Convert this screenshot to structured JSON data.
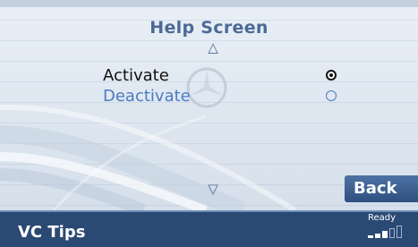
{
  "screen": {
    "title": "Help Screen",
    "scroll_up_symbol": "△",
    "scroll_down_symbol": "▽"
  },
  "options": [
    {
      "label": "Activate",
      "selected": true
    },
    {
      "label": "Deactivate",
      "selected": false
    }
  ],
  "buttons": {
    "back_label": "Back"
  },
  "status_bar": {
    "title": "VC Tips",
    "status": "Ready",
    "signal_level": "3 of 5"
  },
  "colors": {
    "accent": "#4c6a96",
    "option_inactive": "#4a7bc1",
    "status_bar": "#2b4a73",
    "button": "#3d6191"
  },
  "icons": [
    "radio-selected-icon",
    "radio-unselected-icon",
    "scroll-up-icon",
    "scroll-down-icon",
    "signal-strength-icon",
    "mercedes-star-logo"
  ]
}
